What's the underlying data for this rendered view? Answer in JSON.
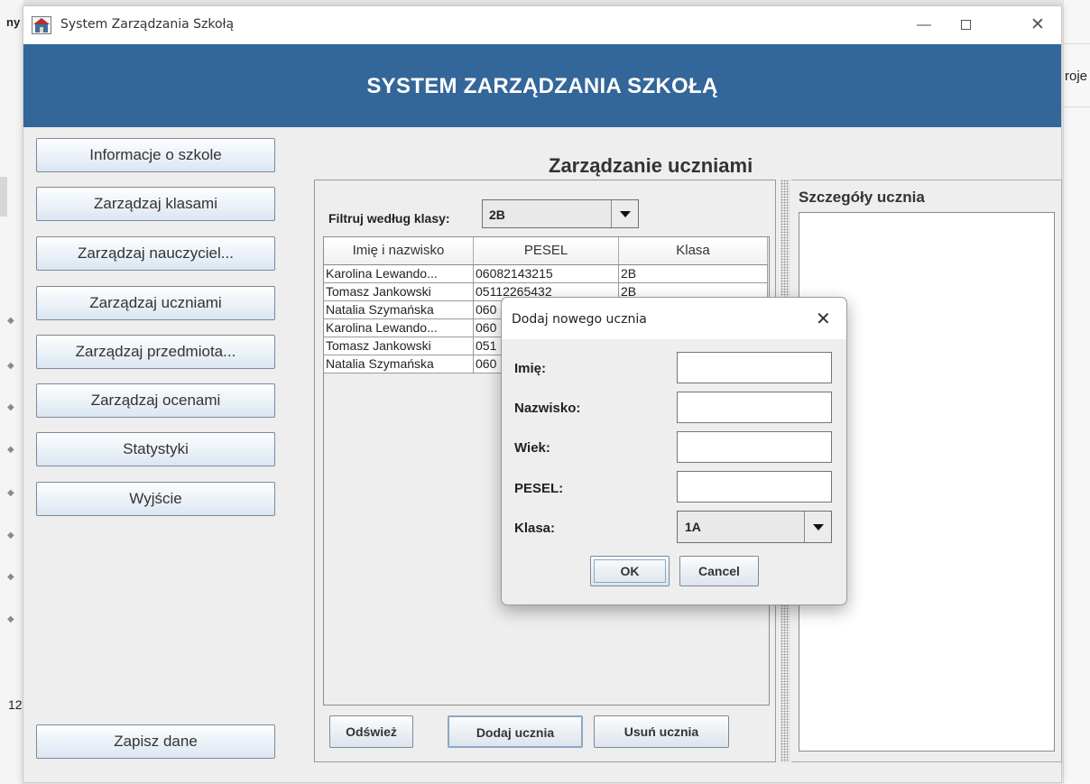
{
  "background_app": {
    "top_left_text": "ny",
    "right_text": "roje",
    "left_number": "12"
  },
  "window": {
    "title": "System Zarządzania Szkołą",
    "controls": {
      "minimize": "—",
      "close": "✕"
    }
  },
  "header": {
    "title": "SYSTEM ZARZĄDZANIA SZKOŁĄ",
    "bg_color": "#336699"
  },
  "nav": {
    "items": [
      {
        "label": "Informacje o szkole"
      },
      {
        "label": "Zarządzaj klasami"
      },
      {
        "label": "Zarządzaj nauczyciel..."
      },
      {
        "label": "Zarządzaj uczniami"
      },
      {
        "label": "Zarządzaj przedmiota..."
      },
      {
        "label": "Zarządzaj ocenami"
      },
      {
        "label": "Statystyki"
      },
      {
        "label": "Wyjście"
      }
    ],
    "save_label": "Zapisz dane"
  },
  "main": {
    "title": "Zarządzanie uczniami",
    "filter": {
      "label": "Filtruj według klasy:",
      "value": "2B"
    },
    "table": {
      "columns": [
        "Imię i nazwisko",
        "PESEL",
        "Klasa"
      ],
      "rows": [
        {
          "name": "Karolina Lewando...",
          "pesel": "06082143215",
          "class": "2B"
        },
        {
          "name": "Tomasz Jankowski",
          "pesel": "05112265432",
          "class": "2B"
        },
        {
          "name": "Natalia Szymańska",
          "pesel": "060",
          "class": ""
        },
        {
          "name": "Karolina Lewando...",
          "pesel": "060",
          "class": ""
        },
        {
          "name": "Tomasz Jankowski",
          "pesel": "051",
          "class": ""
        },
        {
          "name": "Natalia Szymańska",
          "pesel": "060",
          "class": ""
        }
      ]
    },
    "buttons": {
      "refresh": "Odśwież",
      "add": "Dodaj ucznia",
      "remove": "Usuń ucznia"
    }
  },
  "details": {
    "title": "Szczegóły ucznia"
  },
  "dialog": {
    "title": "Dodaj nowego ucznia",
    "close": "✕",
    "fields": [
      {
        "label": "Imię:",
        "value": ""
      },
      {
        "label": "Nazwisko:",
        "value": ""
      },
      {
        "label": "Wiek:",
        "value": ""
      },
      {
        "label": "PESEL:",
        "value": ""
      }
    ],
    "class_label": "Klasa:",
    "class_value": "1A",
    "ok_label": "OK",
    "cancel_label": "Cancel"
  }
}
